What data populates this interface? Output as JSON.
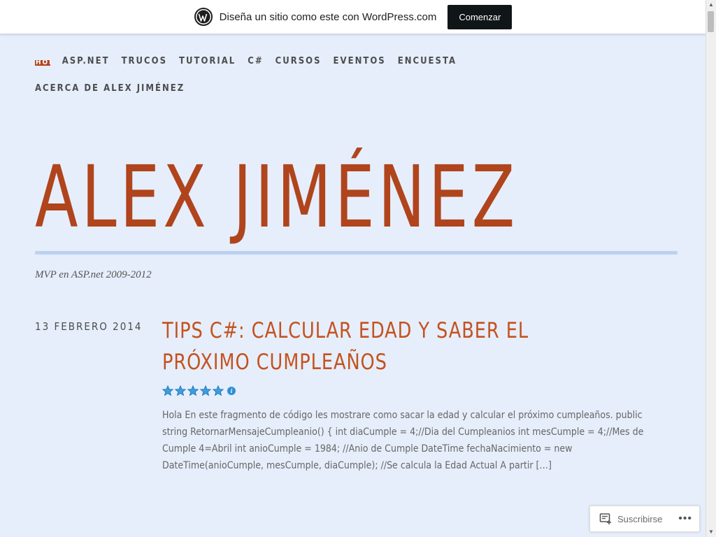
{
  "promo": {
    "text": "Diseña un sitio como este con WordPress.com",
    "button": "Comenzar"
  },
  "nav": {
    "items": [
      {
        "label": "HOME",
        "active": true
      },
      {
        "label": "ASP.NET"
      },
      {
        "label": "TRUCOS"
      },
      {
        "label": "TUTORIAL"
      },
      {
        "label": "C#"
      },
      {
        "label": "CURSOS"
      },
      {
        "label": "EVENTOS"
      },
      {
        "label": "ENCUESTA"
      },
      {
        "label": "ACERCA DE ALEX JIMÉNEZ"
      }
    ]
  },
  "site": {
    "title": "ALEX JIMÉNEZ",
    "tagline": "MVP en ASP.net 2009-2012"
  },
  "post": {
    "date": "13 FEBRERO 2014",
    "title": "TIPS C#: CALCULAR EDAD Y SABER EL PRÓXIMO CUMPLEAÑOS",
    "rating_stars": 5,
    "rating_info_icon": "info-icon",
    "excerpt": "Hola En este fragmento de código les mostrare como sacar la edad y calcular el próximo cumpleaños. public string RetornarMensajeCumpleanio() { int diaCumple = 4;//Dia del Cumpleanios int mesCumple = 4;//Mes de Cumple 4=Abril int anioCumple = 1984; //Anio de Cumple DateTime fechaNacimiento = new DateTime(anioCumple, mesCumple, diaCumple); //Se calcula la Edad Actual A partir […]"
  },
  "subscribe": {
    "label": "Suscribirse",
    "more": "•••"
  },
  "colors": {
    "accent": "#b0441c",
    "post_title": "#c4521f",
    "background": "#e6eefb",
    "rule": "#bcd1f0"
  }
}
